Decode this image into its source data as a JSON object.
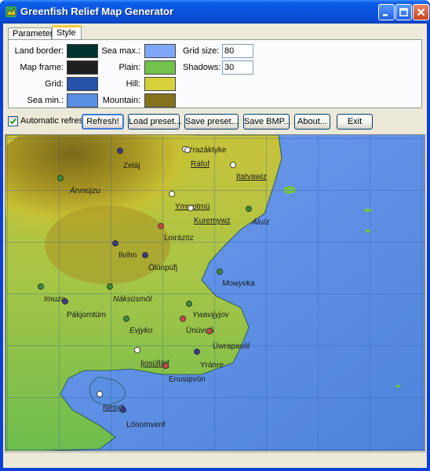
{
  "window": {
    "title": "Greenfish Relief Map Generator"
  },
  "tabs": [
    {
      "label": "Parameters",
      "active": false
    },
    {
      "label": "Style",
      "active": true
    }
  ],
  "style": {
    "land_border": {
      "label": "Land border:",
      "color": "#00332e"
    },
    "map_frame": {
      "label": "Map frame:",
      "color": "#1f1f1f"
    },
    "grid": {
      "label": "Grid:",
      "color": "#2652a8"
    },
    "sea_min": {
      "label": "Sea min.:",
      "color": "#5a8ee0"
    },
    "sea_max": {
      "label": "Sea max.:",
      "color": "#7fa6f8"
    },
    "plain": {
      "label": "Plain:",
      "color": "#72c24e"
    },
    "hill": {
      "label": "Hill:",
      "color": "#d6d13a"
    },
    "mountain": {
      "label": "Mountain:",
      "color": "#85721c"
    },
    "grid_size": {
      "label": "Grid size:",
      "value": "80"
    },
    "shadows": {
      "label": "Shadows:",
      "value": "30"
    }
  },
  "controls": {
    "auto_refresh_label": "Automatic refresh",
    "auto_refresh_checked": true,
    "refresh_label": "Refresh!",
    "load_preset_label": "Load preset...",
    "save_preset_label": "Save preset...",
    "save_bmp_label": "Save BMP...",
    "about_label": "About...",
    "exit_label": "Exit"
  },
  "map": {
    "places": [
      {
        "name": "Yrazáktyke",
        "dot": "white",
        "style": "normal"
      },
      {
        "name": "Zeláj",
        "dot": "navy",
        "style": "normal"
      },
      {
        "name": "Ráfof",
        "dot": "white",
        "style": "underline"
      },
      {
        "name": "Itatvawiz",
        "dot": "white",
        "style": "underline"
      },
      {
        "name": "Ánmüjzu",
        "dot": "green",
        "style": "italic"
      },
      {
        "name": "Ymwotmü",
        "dot": "white",
        "style": "underline"
      },
      {
        "name": "Kuremywz",
        "dot": "white",
        "style": "underline"
      },
      {
        "name": "Áluíz",
        "dot": "green",
        "style": "italic"
      },
      {
        "name": "Loirázöz",
        "dot": "red",
        "style": "normal"
      },
      {
        "name": "Ilvihn",
        "dot": "navy",
        "style": "normal"
      },
      {
        "name": "Ölünpüfj",
        "dot": "navy",
        "style": "normal"
      },
      {
        "name": "Mowyvka",
        "dot": "green",
        "style": "italic"
      },
      {
        "name": "Imuza",
        "dot": "green",
        "style": "italic"
      },
      {
        "name": "Náksüsmöl",
        "dot": "green",
        "style": "italic"
      },
      {
        "name": "Pákjomtüm",
        "dot": "navy",
        "style": "normal"
      },
      {
        "name": "Ywavijyjov",
        "dot": "green",
        "style": "italic"
      },
      {
        "name": "Evjyko",
        "dot": "green",
        "style": "italic"
      },
      {
        "name": "Ünüvoili",
        "dot": "red",
        "style": "normal"
      },
      {
        "name": "Üwrapavöl",
        "dot": "red",
        "style": "normal"
      },
      {
        "name": "Ijosüllätf",
        "dot": "white",
        "style": "underline"
      },
      {
        "name": "Yránre",
        "dot": "navy",
        "style": "normal"
      },
      {
        "name": "Enusipvün",
        "dot": "red",
        "style": "normal"
      },
      {
        "name": "Nesyti",
        "dot": "white",
        "style": "underline"
      },
      {
        "name": "Lönomvenf",
        "dot": "navy",
        "style": "normal"
      }
    ]
  },
  "colors": {
    "titlebar": "#0a53dc",
    "client": "#ece9d8",
    "accent_tab": "#ffc83c"
  }
}
